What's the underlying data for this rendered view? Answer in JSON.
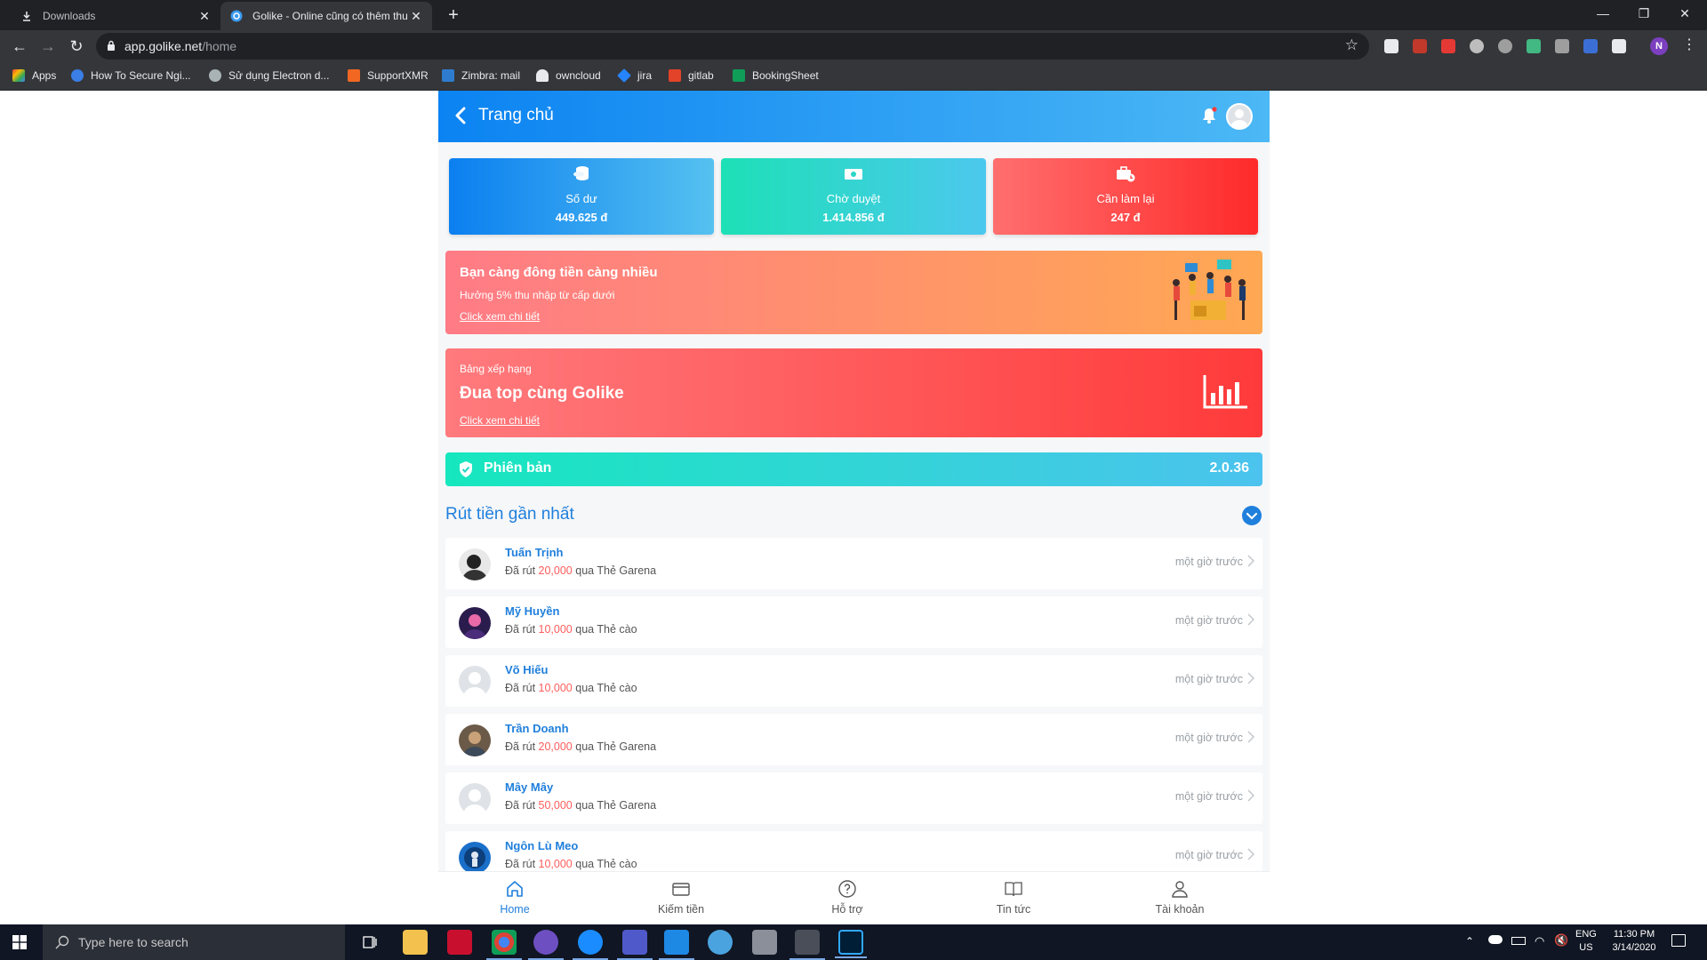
{
  "browser": {
    "tabs": [
      {
        "title": "Downloads",
        "icon": "download-icon",
        "active": false
      },
      {
        "title": "Golike - Online cũng có thêm thu nhập",
        "icon": "golike-favicon",
        "active": true
      }
    ],
    "url_host": "app.golike.net",
    "url_path": "/home",
    "bookmarks": [
      "Apps",
      "How To Secure Ngi...",
      "Sử dụng Electron d...",
      "SupportXMR",
      "Zimbra: mail",
      "owncloud",
      "jira",
      "gitlab",
      "BookingSheet"
    ],
    "profile_initial": "N"
  },
  "app": {
    "title": "Trang chủ",
    "stats": [
      {
        "label": "Số dư",
        "value": "449.625 đ"
      },
      {
        "label": "Chờ duyệt",
        "value": "1.414.856 đ"
      },
      {
        "label": "Cần làm lại",
        "value": "247 đ"
      }
    ],
    "referral": {
      "title": "Bạn càng đông tiền càng nhiều",
      "subtitle": "Hưởng 5% thu nhập từ cấp dưới",
      "link": "Click xem chi tiết"
    },
    "ranking": {
      "caption": "Bảng xếp hạng",
      "title": "Đua top cùng Golike",
      "link": "Click xem chi tiết"
    },
    "version": {
      "label": "Phiên bản",
      "number": "2.0.36"
    },
    "withdrawals_title": "Rút tiền gần nhất",
    "withdrawals": [
      {
        "name": "Tuấn Trịnh",
        "prefix": "Đã rút",
        "amount": "20,000",
        "method": "qua Thẻ Garena",
        "time": "một giờ trước"
      },
      {
        "name": "Mỹ Huyền",
        "prefix": "Đã rút",
        "amount": "10,000",
        "method": "qua Thẻ cào",
        "time": "một giờ trước"
      },
      {
        "name": "Võ Hiếu",
        "prefix": "Đã rút",
        "amount": "10,000",
        "method": "qua Thẻ cào",
        "time": "một giờ trước"
      },
      {
        "name": "Trần Doanh",
        "prefix": "Đã rút",
        "amount": "20,000",
        "method": "qua Thẻ Garena",
        "time": "một giờ trước"
      },
      {
        "name": "Mây Mây",
        "prefix": "Đã rút",
        "amount": "50,000",
        "method": "qua Thẻ Garena",
        "time": "một giờ trước"
      },
      {
        "name": "Ngôn Lù Meo",
        "prefix": "Đã rút",
        "amount": "10,000",
        "method": "qua Thẻ cào",
        "time": "một giờ trước"
      }
    ],
    "nav": [
      {
        "label": "Home",
        "icon": "home-icon",
        "active": true
      },
      {
        "label": "Kiếm tiền",
        "icon": "wallet-icon",
        "active": false
      },
      {
        "label": "Hỗ trợ",
        "icon": "help-icon",
        "active": false
      },
      {
        "label": "Tin tức",
        "icon": "news-icon",
        "active": false
      },
      {
        "label": "Tài khoản",
        "icon": "user-icon",
        "active": false
      }
    ],
    "colors": {
      "primary": "#1f7fdc",
      "amount": "#ff5c5c"
    }
  },
  "taskbar": {
    "search_placeholder": "Type here to search",
    "lang": "ENG",
    "region": "US",
    "time": "11:30 PM",
    "date": "3/14/2020"
  }
}
